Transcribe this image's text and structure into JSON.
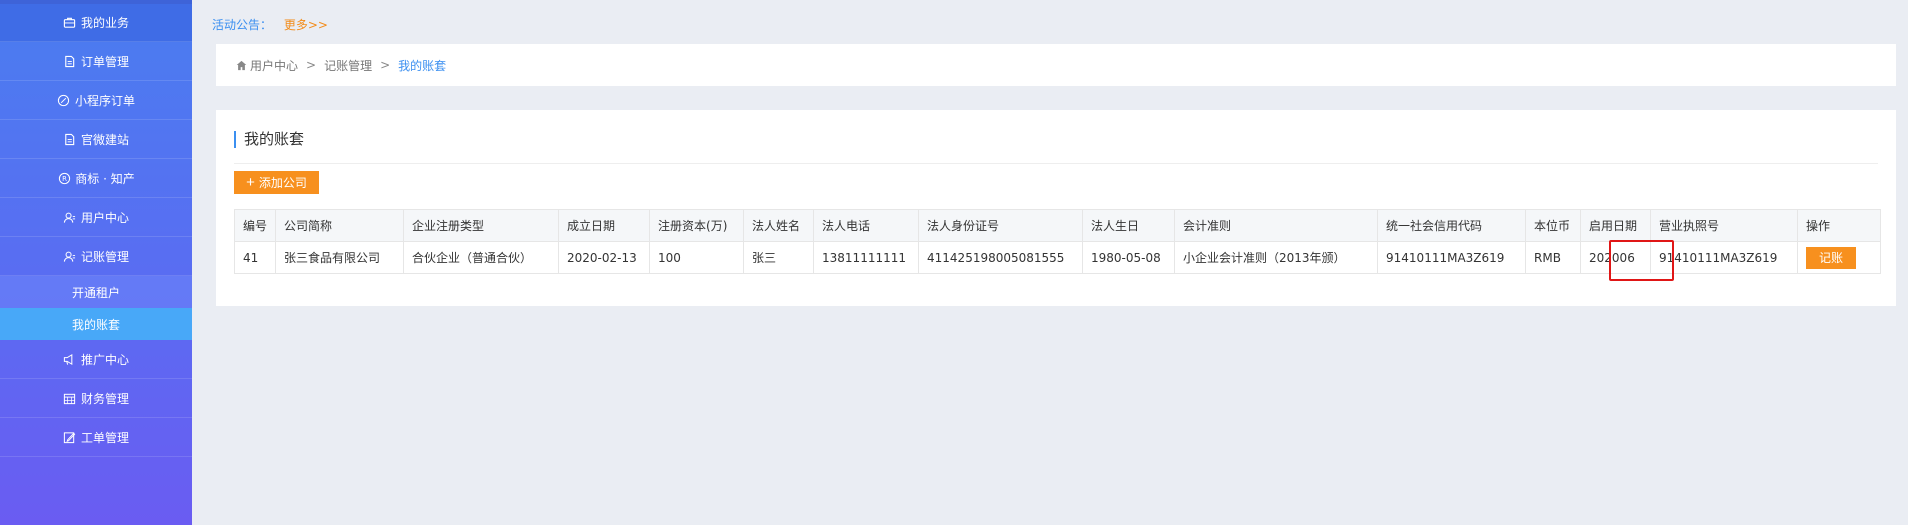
{
  "sidebar": {
    "items": [
      {
        "label": "我的业务",
        "icon": "briefcase-icon"
      },
      {
        "label": "订单管理",
        "icon": "document-icon"
      },
      {
        "label": "小程序订单",
        "icon": "mini-program-icon"
      },
      {
        "label": "官微建站",
        "icon": "document-icon"
      },
      {
        "label": "商标 · 知产",
        "icon": "registered-trademark-icon"
      },
      {
        "label": "用户中心",
        "icon": "user-icon"
      },
      {
        "label": "记账管理",
        "icon": "user-icon"
      }
    ],
    "subitems": [
      {
        "label": "开通租户"
      },
      {
        "label": "我的账套"
      }
    ],
    "items2": [
      {
        "label": "推广中心",
        "icon": "megaphone-icon"
      },
      {
        "label": "财务管理",
        "icon": "calendar-icon"
      },
      {
        "label": "工单管理",
        "icon": "edit-icon"
      }
    ]
  },
  "notice": {
    "label": "活动公告：",
    "more": "更多>>"
  },
  "breadcrumb": {
    "home": "用户中心",
    "sep": ">",
    "level2": "记账管理",
    "current": "我的账套"
  },
  "panel": {
    "title": "我的账套",
    "add_label": "添加公司"
  },
  "table": {
    "headers": [
      "编号",
      "公司简称",
      "企业注册类型",
      "成立日期",
      "注册资本(万)",
      "法人姓名",
      "法人电话",
      "法人身份证号",
      "法人生日",
      "会计准则",
      "统一社会信用代码",
      "本位币",
      "启用日期",
      "营业执照号",
      "操作"
    ],
    "rows": [
      [
        "41",
        "张三食品有限公司",
        "合伙企业（普通合伙）",
        "2020-02-13",
        "100",
        "张三",
        "13811111111",
        "411425198005081555",
        "1980-05-08",
        "小企业会计准则（2013年颁）",
        "91410111MA3Z619",
        "RMB",
        "202006",
        "91410111MA3Z619",
        "记账"
      ]
    ]
  },
  "colors": {
    "accent": "#3b8ff0",
    "orange": "#f7901e",
    "highlight": "#e01616"
  }
}
